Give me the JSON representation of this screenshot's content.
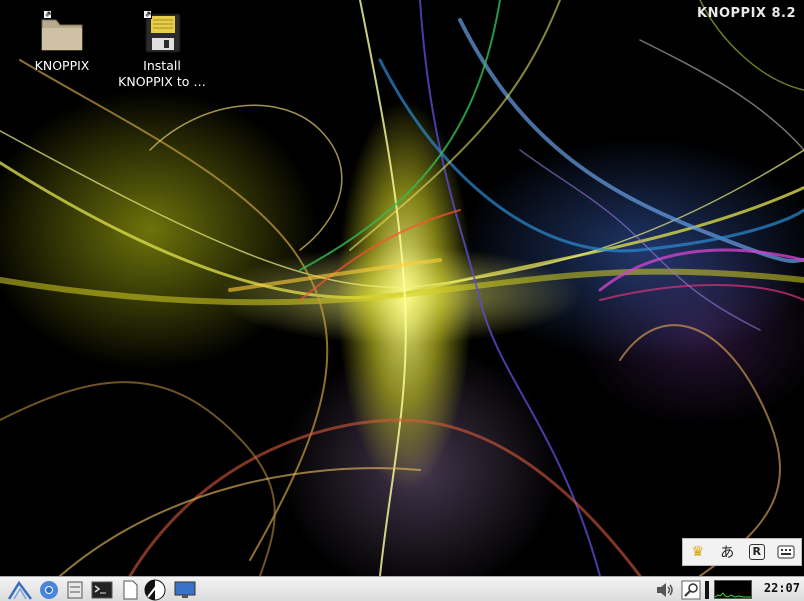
{
  "brand": {
    "text": "KNOPPIX 8.2"
  },
  "desktop_icons": [
    {
      "label": "KNOPPIX",
      "icon": "folder-icon"
    },
    {
      "label_line1": "Install",
      "label_line2": "KNOPPIX to …",
      "icon": "floppy-disk-icon"
    }
  ],
  "im_tray": {
    "items": [
      {
        "name": "crown-icon",
        "glyph": "♛"
      },
      {
        "name": "hiragana-icon",
        "glyph": "あ"
      },
      {
        "name": "r-icon",
        "glyph": "R"
      },
      {
        "name": "keyboard-icon",
        "glyph": ""
      }
    ]
  },
  "taskbar": {
    "buttons": [
      "menu-icon",
      "chromium-icon",
      "file-manager-icon",
      "terminal-icon",
      "document-icon",
      "knoppix-logo-icon",
      "monitor-icon"
    ],
    "tray": [
      "volume-icon",
      "search-icon",
      "cpu-graph"
    ],
    "clock": "22:07"
  },
  "colors": {
    "taskbar_bg": "#e6e6e6",
    "desktop_bg": "#000000",
    "brand_text": "#e8e8e8"
  }
}
